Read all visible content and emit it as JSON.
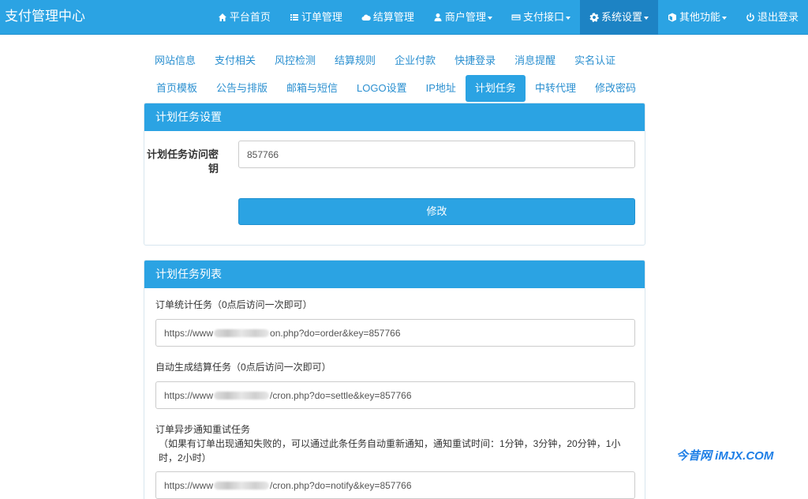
{
  "app": {
    "title": "支付管理中心"
  },
  "nav": {
    "items": [
      {
        "label": "平台首页",
        "icon": "home-icon"
      },
      {
        "label": "订单管理",
        "icon": "list-icon"
      },
      {
        "label": "结算管理",
        "icon": "cloud-icon"
      },
      {
        "label": "商户管理",
        "icon": "user-icon",
        "dropdown": true
      },
      {
        "label": "支付接口",
        "icon": "credit-card-icon",
        "dropdown": true
      },
      {
        "label": "系统设置",
        "icon": "gear-icon",
        "dropdown": true,
        "active": true
      },
      {
        "label": "其他功能",
        "icon": "cube-icon",
        "dropdown": true
      },
      {
        "label": "退出登录",
        "icon": "power-icon"
      }
    ]
  },
  "tabs": {
    "row1": [
      "网站信息",
      "支付相关",
      "风控检测",
      "结算规则",
      "企业付款",
      "快捷登录",
      "消息提醒",
      "实名认证"
    ],
    "row2": [
      "首页模板",
      "公告与排版",
      "邮箱与短信",
      "LOGO设置",
      "IP地址",
      "计划任务",
      "中转代理",
      "修改密码"
    ],
    "active": "计划任务"
  },
  "settings_panel": {
    "title": "计划任务设置",
    "key_label": "计划任务访问密钥",
    "key_value": "857766",
    "submit_label": "修改"
  },
  "tasks_panel": {
    "title": "计划任务列表",
    "tasks": [
      {
        "label": "订单统计任务（0点后访问一次即可）",
        "url_prefix": "https://www",
        "url_suffix": "on.php?do=order&key=857766"
      },
      {
        "label": "自动生成结算任务（0点后访问一次即可）",
        "url_prefix": "https://www",
        "url_suffix": "/cron.php?do=settle&key=857766"
      },
      {
        "label": "订单异步通知重试任务",
        "note": "（如果有订单出现通知失败的，可以通过此条任务自动重新通知，通知重试时间：1分钟，3分钟，20分钟，1小时，2小时）",
        "url_prefix": "https://www",
        "url_suffix": "/cron.php?do=notify&key=857766"
      }
    ]
  },
  "watermark": "今昔网 iMJX.COM",
  "colors": {
    "primary": "#2ba3e3",
    "primary_dark": "#1d83c4",
    "link": "#2a8fd0"
  }
}
